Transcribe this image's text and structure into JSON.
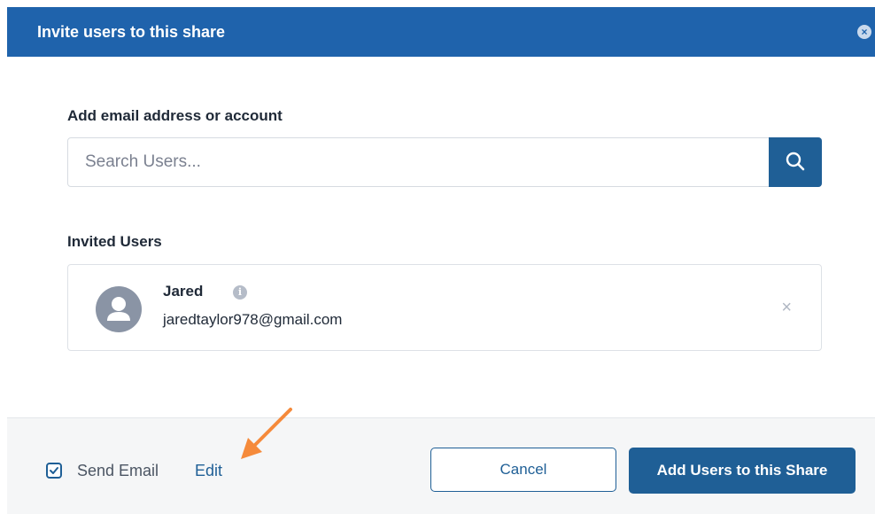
{
  "dialog": {
    "title": "Invite users to this share",
    "close_icon": "close-icon"
  },
  "search": {
    "label": "Add email address or account",
    "placeholder": "Search Users...",
    "value": "",
    "button_icon": "search-icon"
  },
  "invited": {
    "label": "Invited Users",
    "users": [
      {
        "name": "Jared",
        "email": "jaredtaylor978@gmail.com",
        "avatar_icon": "user-avatar-icon",
        "info_icon": "info-icon",
        "remove_icon": "close-icon",
        "remove_label": "×"
      }
    ]
  },
  "footer": {
    "send_email_label": "Send Email",
    "send_email_checked": true,
    "edit_label": "Edit",
    "cancel_label": "Cancel",
    "submit_label": "Add Users to this Share"
  },
  "colors": {
    "header": "#1f63ac",
    "primary": "#1f5f96",
    "annotation_arrow": "#f58a3b"
  }
}
